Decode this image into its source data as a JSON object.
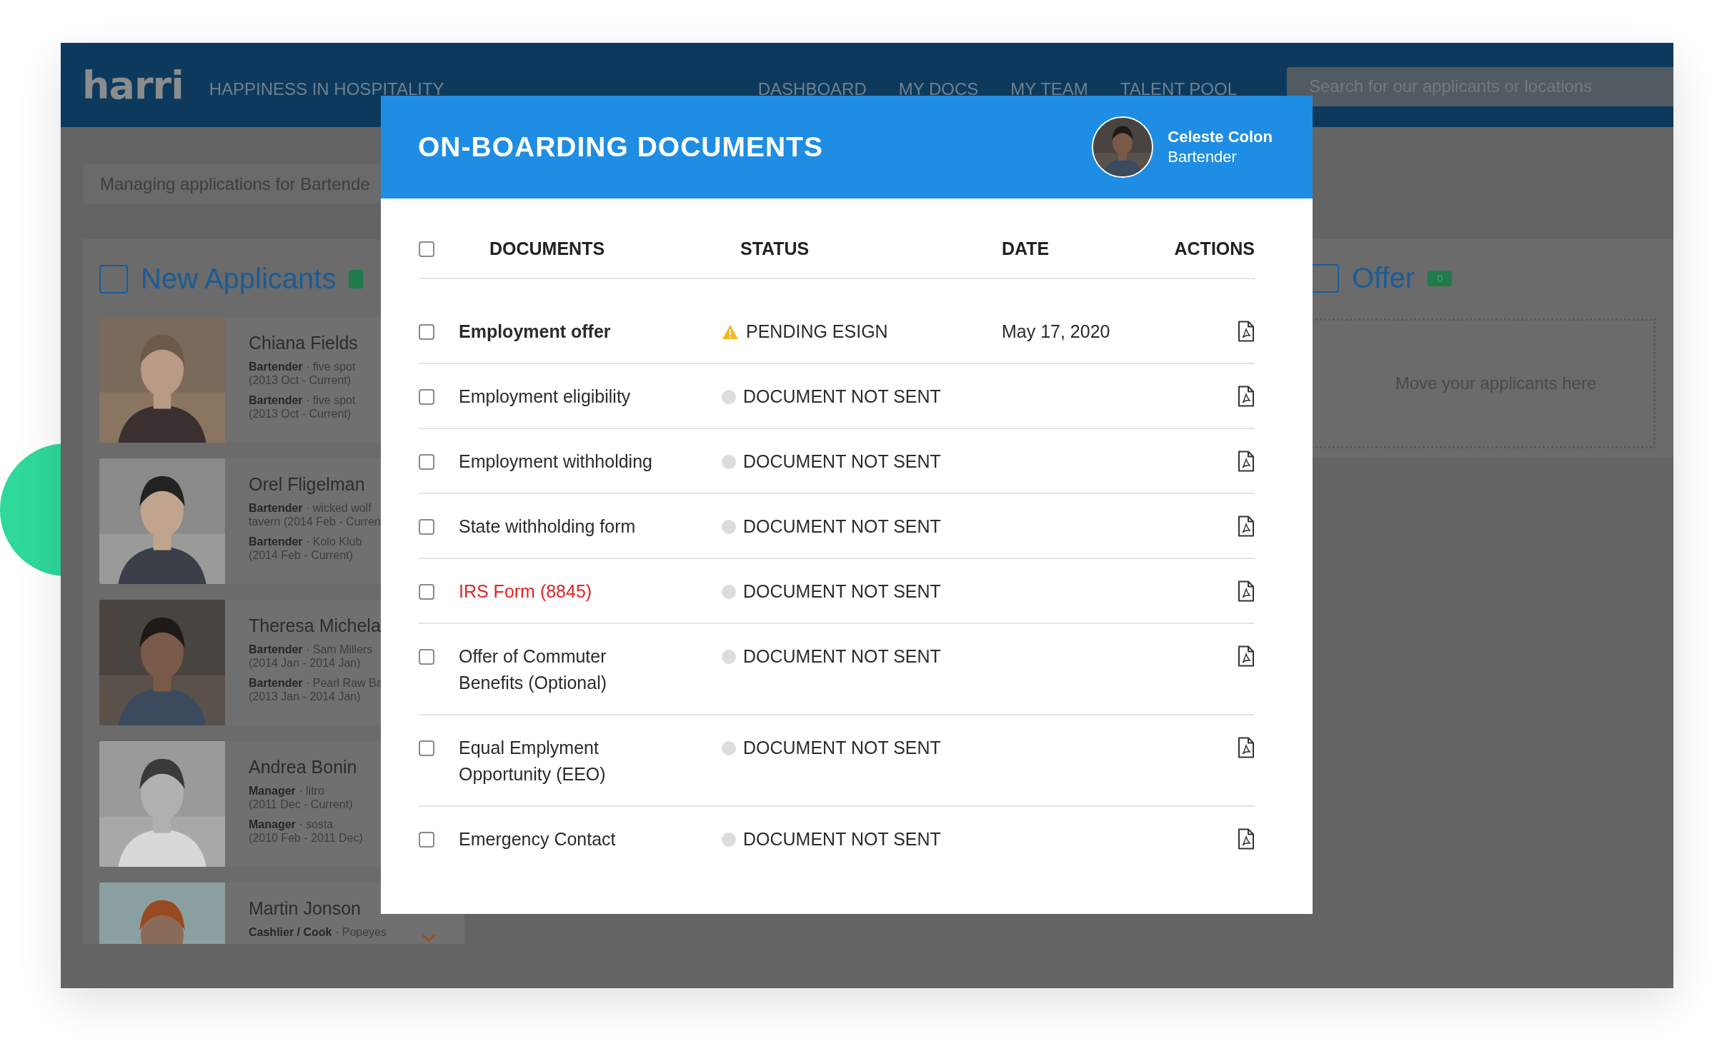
{
  "header": {
    "logo": "harri",
    "tagline": "HAPPINESS IN HOSPITALITY",
    "nav": [
      "DASHBOARD",
      "MY DOCS",
      "MY TEAM",
      "TALENT POOL"
    ],
    "search": {
      "placeholder": "Search for our applicants or locations"
    }
  },
  "context_bar": {
    "text": "Managing applications for Bartende"
  },
  "new_applicants": {
    "title": "New Applicants",
    "checked": false,
    "applicants": [
      {
        "name": "Chiana Fields",
        "jobs": [
          {
            "text": "**Bartender** · five spot",
            "period": "(2013 Oct - Current)"
          },
          {
            "text": "**Bartender** · five spot",
            "period": "(2013 Oct - Current)"
          }
        ]
      },
      {
        "name": "Orel Fligelman",
        "jobs": [
          {
            "text": "**Bartender** · wicked wolf",
            "period": "tavern (2014 Feb - Curren"
          },
          {
            "text": "**Bartender** · Kolo Klub",
            "period": "(2014 Feb - Current)"
          }
        ]
      },
      {
        "name": "Theresa Michela",
        "jobs": [
          {
            "text": "**Bartender** · Sam Millers",
            "period": "(2014 Jan - 2014 Jan)"
          },
          {
            "text": "**Bartender** · Pearl Raw Ba",
            "period": "(2013 Jan - 2014 Jan)"
          }
        ]
      },
      {
        "name": "Andrea Bonin",
        "jobs": [
          {
            "text": "**Manager** · litro",
            "period": "(2011 Dec - Current)"
          },
          {
            "text": "**Manager** · sosta",
            "period": "(2010 Feb - 2011 Dec)"
          }
        ]
      },
      {
        "name": "Martin Jonson",
        "jobs": [
          {
            "text": "**Cashlier / Cook** · Popeyes"
          }
        ]
      }
    ]
  },
  "offer": {
    "title": "Offer",
    "checked": false,
    "count": "0",
    "empty_text": "Move your applicants here"
  },
  "modal": {
    "title": "ON-BOARDING DOCUMENTS",
    "person": {
      "name": "Celeste Colon",
      "role": "Bartender"
    },
    "select_all": {
      "checked": false
    },
    "columns": [
      "DOCUMENTS",
      "STATUS",
      "DATE",
      "ACTIONS"
    ],
    "documents": [
      {
        "name": "Employment offer",
        "kind": "current",
        "checked": false,
        "status": "PENDING ESIGN",
        "pending": true,
        "date": "May 17, 2020"
      },
      {
        "name": "Employment eligibility",
        "kind": "regular",
        "checked": false,
        "status": "DOCUMENT NOT SENT",
        "pending": false
      },
      {
        "name": "Employment withholding",
        "kind": "regular",
        "checked": false,
        "status": "DOCUMENT NOT SENT",
        "pending": false
      },
      {
        "name": "State withholding form",
        "kind": "regular",
        "checked": false,
        "status": "DOCUMENT NOT SENT",
        "pending": false
      },
      {
        "name": "IRS Form (8845)",
        "kind": "required",
        "checked": false,
        "status": "DOCUMENT NOT SENT",
        "pending": false
      },
      {
        "name": "Offer of Commuter Benefits (Optional)",
        "kind": "regular",
        "checked": false,
        "status": "DOCUMENT NOT SENT",
        "pending": false
      },
      {
        "name": "Equal Emplyment Opportunity (EEO)",
        "kind": "regular",
        "checked": false,
        "status": "DOCUMENT NOT SENT",
        "pending": false
      },
      {
        "name": "Emergency Contact",
        "kind": "regular",
        "checked": false,
        "status": "DOCUMENT NOT SENT",
        "pending": false
      }
    ]
  }
}
